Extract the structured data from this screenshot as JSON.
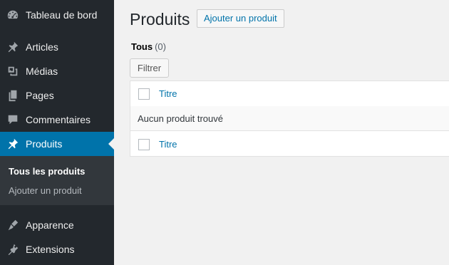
{
  "sidebar": {
    "items": [
      {
        "label": "Tableau de bord",
        "icon": "dashboard-icon"
      },
      {
        "label": "Articles",
        "icon": "pin-icon"
      },
      {
        "label": "Médias",
        "icon": "media-icon"
      },
      {
        "label": "Pages",
        "icon": "pages-icon"
      },
      {
        "label": "Commentaires",
        "icon": "comments-icon"
      },
      {
        "label": "Produits",
        "icon": "pin-icon",
        "current": true
      },
      {
        "label": "Apparence",
        "icon": "appearance-icon"
      },
      {
        "label": "Extensions",
        "icon": "plugins-icon"
      }
    ],
    "submenu": [
      {
        "label": "Tous les produits",
        "current": true
      },
      {
        "label": "Ajouter un produit"
      }
    ],
    "colors": {
      "background": "#23282d",
      "active": "#0073aa",
      "submenu": "#32373c"
    }
  },
  "main": {
    "title": "Produits",
    "add_button": "Ajouter un produit",
    "views": {
      "label": "Tous",
      "count": "(0)"
    },
    "filter_button": "Filtrer",
    "table": {
      "column_title": "Titre",
      "empty_message": "Aucun produit trouvé"
    },
    "colors": {
      "link": "#0073aa",
      "background": "#f1f1f1"
    }
  }
}
